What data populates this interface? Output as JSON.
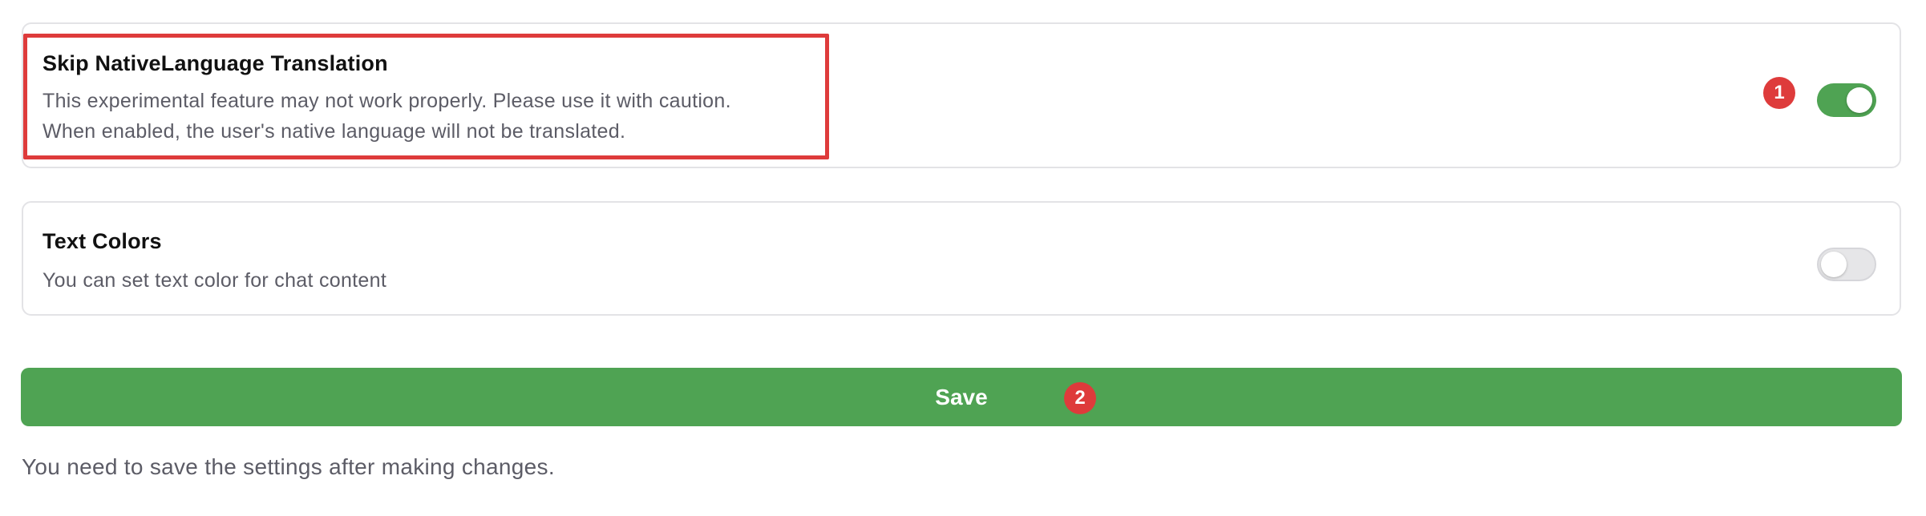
{
  "settings": {
    "skip_native": {
      "title": "Skip NativeLanguage Translation",
      "description_line1": "This experimental feature may not work properly. Please use it with caution.",
      "description_line2": "When enabled, the user's native language will not be translated.",
      "enabled": true
    },
    "text_colors": {
      "title": "Text Colors",
      "description": "You can set text color for chat content",
      "enabled": false
    }
  },
  "annotations": {
    "badge_1": "1",
    "badge_2": "2",
    "highlight_color": "#de3b3b"
  },
  "actions": {
    "save_label": "Save"
  },
  "footer": {
    "note": "You need to save the settings after making changes."
  },
  "colors": {
    "accent_green": "#4fa353",
    "toggle_off": "#e6e6e8",
    "border": "#e3e3e6",
    "muted_text": "#5c5c66"
  }
}
